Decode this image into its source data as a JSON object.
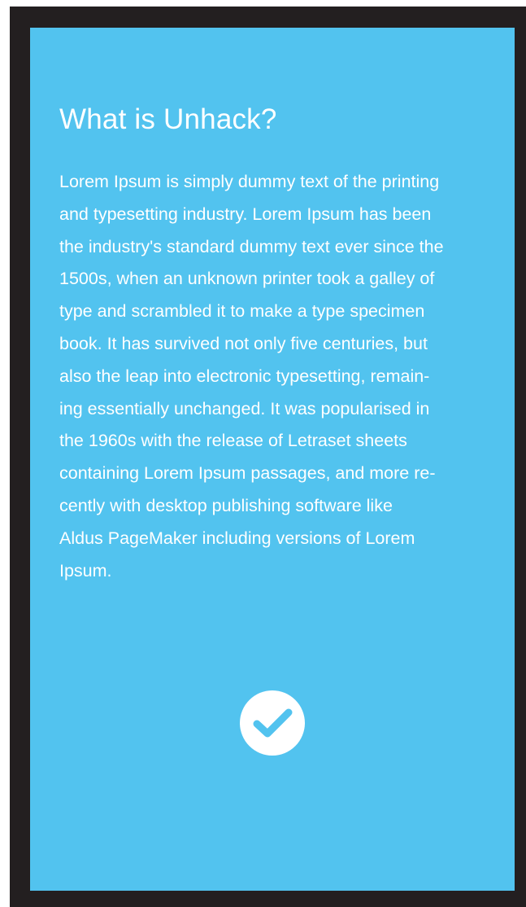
{
  "page": {
    "title": "What is Unhack?",
    "body_lines": [
      "Lorem Ipsum is simply dummy text of the printing",
      "and typesetting industry. Lorem Ipsum has been",
      "the industry's standard dummy text ever since the",
      "1500s, when an unknown printer took a galley of",
      "type and scrambled it to make a type specimen",
      "book. It has survived not only five centuries, but",
      "also the leap into electronic typesetting, remain-",
      "ing essentially unchanged. It was popularised in",
      "the 1960s with the release of Letraset sheets",
      "containing Lorem Ipsum passages, and more re-",
      "cently with desktop publishing software like",
      "Aldus PageMaker including versions of Lorem",
      "Ipsum."
    ]
  },
  "confirm": {
    "icon": "check-circle-icon"
  },
  "colors": {
    "frame": "#231f20",
    "background": "#52c3ef",
    "text": "#ffffff",
    "check": "#52c3ef"
  }
}
